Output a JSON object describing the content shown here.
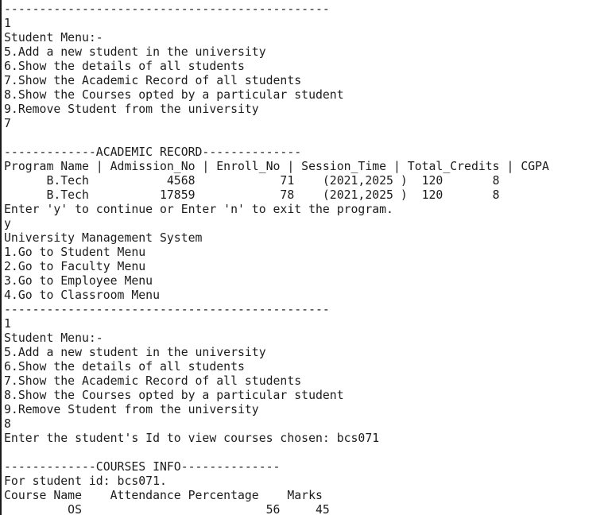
{
  "terminal": {
    "lines": [
      "----------------------------------------------",
      "1",
      "Student Menu:-",
      "5.Add a new student in the university",
      "6.Show the details of all students",
      "7.Show the Academic Record of all students",
      "8.Show the Courses opted by a particular student",
      "9.Remove Student from the university",
      "7",
      "",
      "-------------ACADEMIC RECORD--------------",
      "Program Name | Admission_No | Enroll_No | Session_Time | Total_Credits | CGPA",
      "      B.Tech           4568            71    (2021,2025 )  120       8",
      "      B.Tech          17859            78    (2021,2025 )  120       8",
      "Enter 'y' to continue or Enter 'n' to exit the program.",
      "y",
      "University Management System",
      "1.Go to Student Menu",
      "2.Go to Faculty Menu",
      "3.Go to Employee Menu",
      "4.Go to Classroom Menu",
      "----------------------------------------------",
      "1",
      "Student Menu:-",
      "5.Add a new student in the university",
      "6.Show the details of all students",
      "7.Show the Academic Record of all students",
      "8.Show the Courses opted by a particular student",
      "9.Remove Student from the university",
      "8",
      "Enter the student's Id to view courses chosen: bcs071",
      "",
      "-------------COURSES INFO--------------",
      "For student id: bcs071.",
      "Course Name    Attendance Percentage    Marks",
      "         OS                          56     45"
    ]
  }
}
